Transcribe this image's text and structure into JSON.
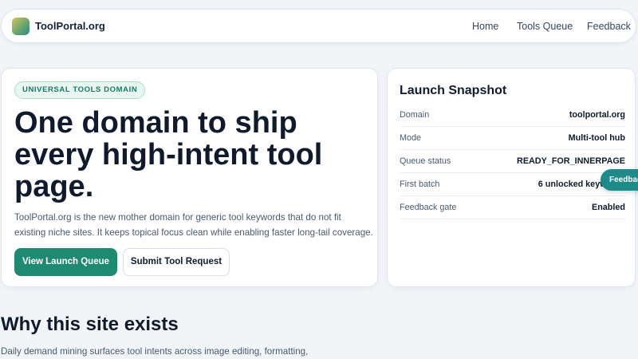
{
  "header": {
    "brand": "ToolPortal.org",
    "logo_icon": "toolportal-logo-icon",
    "nav": {
      "home": "Home",
      "tools_queue": "Tools Queue",
      "feedback": "Feedback"
    }
  },
  "hero": {
    "badge": "UNIVERSAL TOOLS DOMAIN",
    "title": "One domain to ship every high-intent tool page.",
    "description": "ToolPortal.org is the new mother domain for generic tool keywords that do not fit existing niche sites. It keeps topical focus clean while enabling faster long-tail coverage.",
    "primary_button": "View Launch Queue",
    "secondary_button": "Submit Tool Request"
  },
  "snapshot": {
    "title": "Launch Snapshot",
    "rows": [
      {
        "key": "Domain",
        "value": "toolportal.org"
      },
      {
        "key": "Mode",
        "value": "Multi-tool hub"
      },
      {
        "key": "Queue status",
        "value": "READY_FOR_INNERPAGE"
      },
      {
        "key": "First batch",
        "value": "6 unlocked keywords"
      },
      {
        "key": "Feedback gate",
        "value": "Enabled"
      }
    ]
  },
  "feedback_tab": {
    "label": "Feedback"
  },
  "why": {
    "title": "Why this site exists",
    "text": "Daily demand mining surfaces tool intents across image editing, formatting,"
  },
  "colors": {
    "accent": "#1e8a72",
    "feedback_tab": "#1e8a8a",
    "badge_text": "#1a7a64",
    "background": "#f2f5f8"
  }
}
